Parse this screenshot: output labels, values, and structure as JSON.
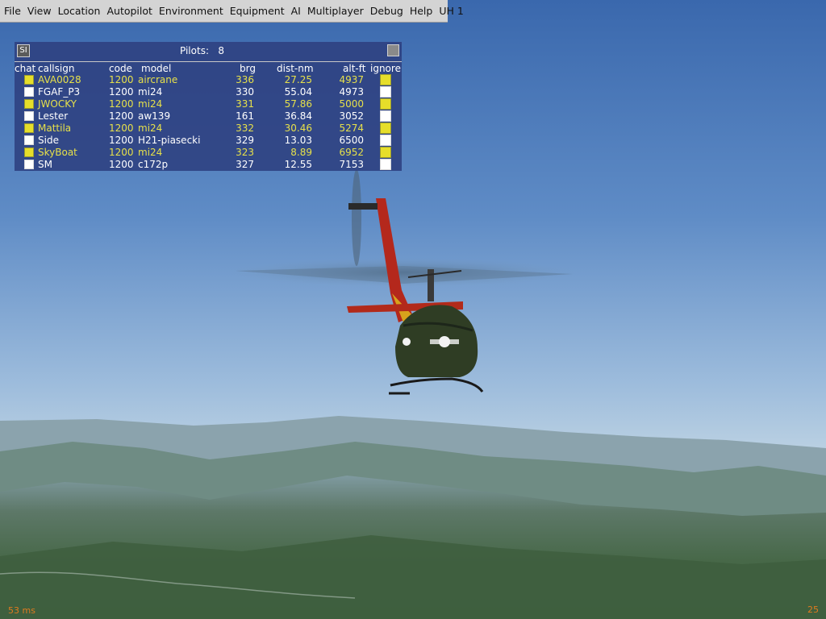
{
  "menu": [
    "File",
    "View",
    "Location",
    "Autopilot",
    "Environment",
    "Equipment",
    "AI",
    "Multiplayer",
    "Debug",
    "Help",
    "UH 1"
  ],
  "pilots_panel": {
    "si_label": "SI",
    "title": "Pilots:   8",
    "columns": {
      "chat": "chat",
      "callsign": "callsign",
      "code": "code",
      "model": "model",
      "brg": "brg",
      "dist": "dist-nm",
      "alt": "alt-ft",
      "ignore": "ignore"
    },
    "rows": [
      {
        "callsign": "AVA0028",
        "code": "1200",
        "model": "aircrane",
        "brg": "336",
        "dist": "27.25",
        "alt": "4937",
        "chat": true,
        "ignore": true
      },
      {
        "callsign": "FGAF_P3",
        "code": "1200",
        "model": "mi24",
        "brg": "330",
        "dist": "55.04",
        "alt": "4973",
        "chat": false,
        "ignore": false
      },
      {
        "callsign": "JWOCKY",
        "code": "1200",
        "model": "mi24",
        "brg": "331",
        "dist": "57.86",
        "alt": "5000",
        "chat": true,
        "ignore": true
      },
      {
        "callsign": "Lester",
        "code": "1200",
        "model": "aw139",
        "brg": "161",
        "dist": "36.84",
        "alt": "3052",
        "chat": false,
        "ignore": false
      },
      {
        "callsign": "Mattila",
        "code": "1200",
        "model": "mi24",
        "brg": "332",
        "dist": "30.46",
        "alt": "5274",
        "chat": true,
        "ignore": true
      },
      {
        "callsign": "Side",
        "code": "1200",
        "model": "H21-piasecki",
        "brg": "329",
        "dist": "13.03",
        "alt": "6500",
        "chat": false,
        "ignore": false
      },
      {
        "callsign": "SkyBoat",
        "code": "1200",
        "model": "mi24",
        "brg": "323",
        "dist": "8.89",
        "alt": "6952",
        "chat": true,
        "ignore": true
      },
      {
        "callsign": "SM",
        "code": "1200",
        "model": "c172p",
        "brg": "327",
        "dist": "12.55",
        "alt": "7153",
        "chat": false,
        "ignore": false
      }
    ]
  },
  "status": {
    "frame_time": "53 ms",
    "fps": "25"
  },
  "colors": {
    "panel_bg": "#2e4080",
    "highlight_text": "#e6e04a",
    "status_text": "#e07a1e",
    "sky_top": "#3f6fb4",
    "sky_horizon": "#b9d0e3"
  }
}
